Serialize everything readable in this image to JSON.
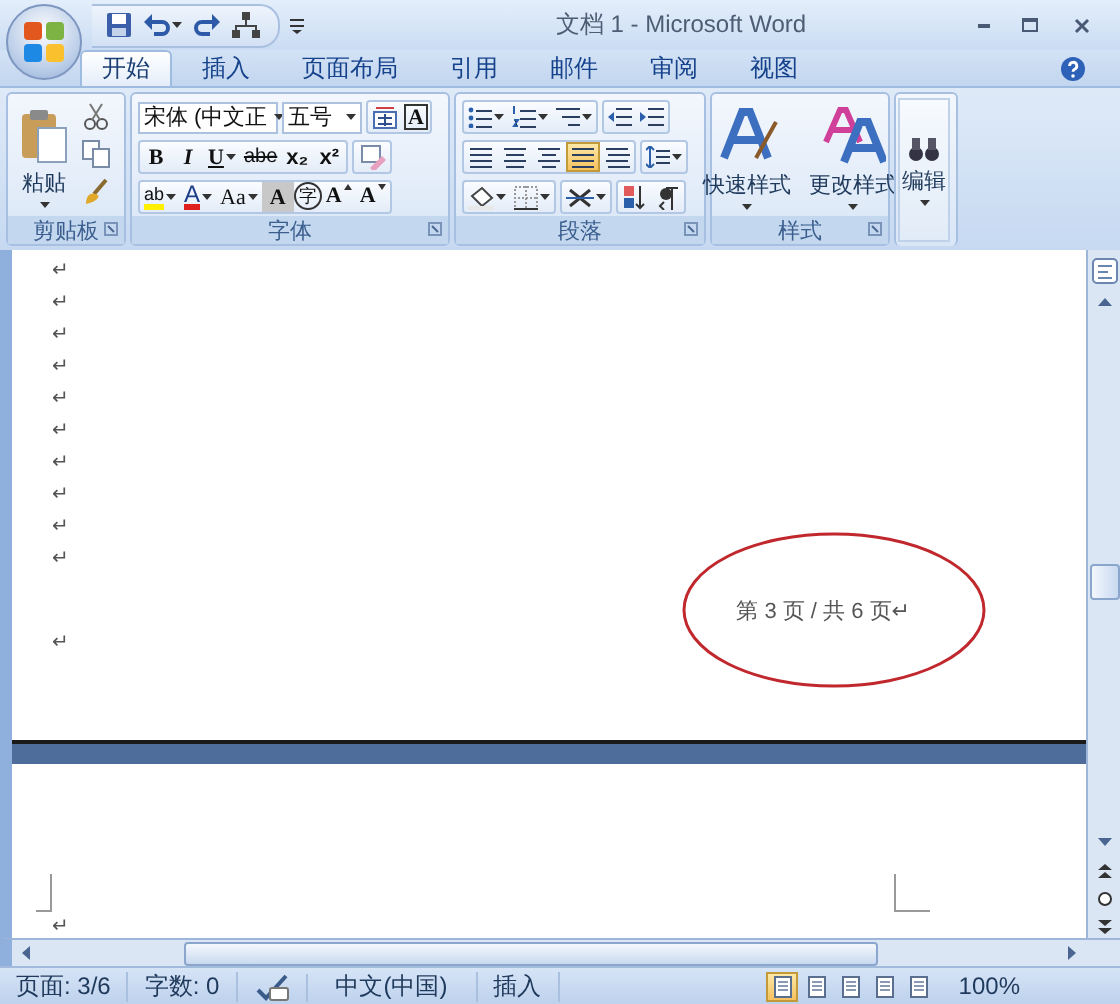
{
  "window": {
    "title": "文档 1 - Microsoft Word"
  },
  "tabs": [
    {
      "label": "开始",
      "selected": true
    },
    {
      "label": "插入",
      "selected": false
    },
    {
      "label": "页面布局",
      "selected": false
    },
    {
      "label": "引用",
      "selected": false
    },
    {
      "label": "邮件",
      "selected": false
    },
    {
      "label": "审阅",
      "selected": false
    },
    {
      "label": "视图",
      "selected": false
    }
  ],
  "ribbon": {
    "groups": [
      {
        "kind": "clipboard",
        "label": "剪贴板",
        "launcher": true,
        "paste_label": "粘贴"
      },
      {
        "kind": "font",
        "label": "字体",
        "launcher": true,
        "font_name": "宋体 (中文正",
        "font_size": "五号",
        "border_button": "A",
        "format_buttons": [
          {
            "kind": "bold",
            "text": "B"
          },
          {
            "kind": "italic",
            "text": "I"
          },
          {
            "kind": "underline",
            "text": "U"
          },
          {
            "kind": "strike",
            "text": "abe"
          },
          {
            "kind": "plain",
            "text": "x₂"
          },
          {
            "kind": "plain",
            "text": "x²"
          }
        ],
        "effect_buttons": [
          {
            "kind": "highlight",
            "text": "ab"
          },
          {
            "kind": "font-color",
            "text": "A"
          },
          {
            "kind": "case",
            "text": "Aa"
          },
          {
            "kind": "shading",
            "text": "A"
          },
          {
            "kind": "enclose",
            "text": "字"
          },
          {
            "kind": "grow",
            "text": "A"
          },
          {
            "kind": "shrink",
            "text": "A"
          }
        ]
      },
      {
        "kind": "paragraph",
        "label": "段落",
        "launcher": true,
        "align_buttons": [
          {
            "selected": false
          },
          {
            "selected": false
          },
          {
            "selected": false
          },
          {
            "selected": true
          },
          {
            "selected": false
          }
        ]
      },
      {
        "kind": "styles",
        "label": "样式",
        "launcher": true,
        "buttons": [
          {
            "label": "快速样式"
          },
          {
            "label": "更改样式"
          }
        ]
      },
      {
        "kind": "editing",
        "button": "编辑"
      }
    ]
  },
  "document": {
    "pages": [
      {
        "marks": [
          "↵",
          "↵",
          "↵",
          "↵",
          "↵",
          "↵",
          "↵",
          "↵",
          "↵",
          "↵"
        ],
        "footer": "第 3 页 / 共 6 页↵",
        "footer_mark": "↵",
        "annotated": true
      },
      {
        "marks": [
          "↵"
        ],
        "annotated": false
      }
    ]
  },
  "status_bar": {
    "page": "页面: 3/6",
    "words": "字数: 0",
    "language": "中文(中国)",
    "mode": "插入",
    "view_buttons": [
      {
        "selected": true
      },
      {
        "selected": false
      },
      {
        "selected": false
      },
      {
        "selected": false
      },
      {
        "selected": false
      }
    ],
    "zoom": "100%"
  }
}
